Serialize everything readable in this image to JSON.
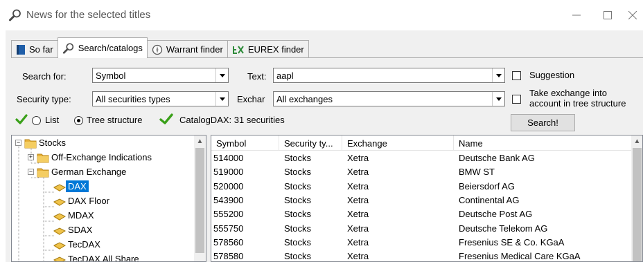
{
  "window": {
    "title": "News for the selected titles"
  },
  "tabs": [
    {
      "label": "So far",
      "icon": "book-icon"
    },
    {
      "label": "Search/catalogs",
      "icon": "magnifier-icon"
    },
    {
      "label": "Warrant finder",
      "icon": "compass-icon"
    },
    {
      "label": "EUREX finder",
      "icon": "eurex-logo-icon"
    }
  ],
  "search": {
    "search_for_label": "Search for:",
    "search_for_value": "Symbol",
    "text_label": "Text:",
    "text_value": "aapl",
    "suggestion_label": "Suggestion",
    "security_type_label": "Security type:",
    "security_type_value": "All securities types",
    "exchange_label": "Exchar",
    "exchange_value": "All exchanges",
    "take_exchange_label_1": "Take exchange into",
    "take_exchange_label_2": "account in tree structure",
    "list_label": "List",
    "tree_label": "Tree structure",
    "catalog_status": "CatalogDAX: 31 securities",
    "search_button": "Search!"
  },
  "tree": {
    "nodes": [
      {
        "label": "Stocks",
        "level": 0,
        "expander": "−"
      },
      {
        "label": "Off-Exchange Indications",
        "level": 1,
        "expander": "+"
      },
      {
        "label": "German Exchange",
        "level": 1,
        "expander": "−"
      },
      {
        "label": "DAX",
        "level": 2,
        "expander": "",
        "selected": true
      },
      {
        "label": "DAX Floor",
        "level": 2,
        "expander": ""
      },
      {
        "label": "MDAX",
        "level": 2,
        "expander": ""
      },
      {
        "label": "SDAX",
        "level": 2,
        "expander": ""
      },
      {
        "label": "TecDAX",
        "level": 2,
        "expander": ""
      },
      {
        "label": "TecDAX All Share",
        "level": 2,
        "expander": ""
      }
    ]
  },
  "grid": {
    "columns": [
      "Symbol",
      "Security ty...",
      "Exchange",
      "Name"
    ],
    "rows": [
      [
        "514000",
        "Stocks",
        "Xetra",
        "Deutsche Bank AG"
      ],
      [
        "519000",
        "Stocks",
        "Xetra",
        "BMW ST"
      ],
      [
        "520000",
        "Stocks",
        "Xetra",
        "Beiersdorf AG"
      ],
      [
        "543900",
        "Stocks",
        "Xetra",
        "Continental AG"
      ],
      [
        "555200",
        "Stocks",
        "Xetra",
        "Deutsche Post AG"
      ],
      [
        "555750",
        "Stocks",
        "Xetra",
        "Deutsche Telekom AG"
      ],
      [
        "578560",
        "Stocks",
        "Xetra",
        "Fresenius SE & Co. KGaA"
      ],
      [
        "578580",
        "Stocks",
        "Xetra",
        "Fresenius Medical Care KGaA"
      ]
    ]
  },
  "colors": {
    "selection": "#0078d7",
    "check_green": "#3aa019",
    "folder": "#e8b23a"
  }
}
